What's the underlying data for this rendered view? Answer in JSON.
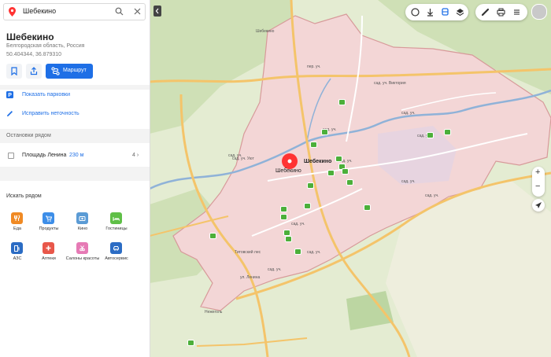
{
  "search": {
    "query": "Шебекино"
  },
  "place": {
    "title": "Шебекино",
    "region": "Белгородская область, Россия",
    "coords": "50.404344, 36.879310"
  },
  "actions": {
    "route_label": "Маршрут",
    "parking_label": "Показать парковки",
    "fix_label": "Исправить неточность"
  },
  "stops": {
    "header": "Остановки рядом",
    "items": [
      {
        "name": "Площадь Ленина",
        "distance": "230 м",
        "count": "4"
      }
    ]
  },
  "nearby": {
    "header": "Искать рядом",
    "categories": [
      {
        "label": "Еда",
        "color": "#f08a24",
        "icon": "food-icon"
      },
      {
        "label": "Продукты",
        "color": "#3d8ee8",
        "icon": "cart-icon"
      },
      {
        "label": "Кино",
        "color": "#5b9bd5",
        "icon": "cinema-icon"
      },
      {
        "label": "Гостиницы",
        "color": "#5fbf47",
        "icon": "hotel-icon"
      },
      {
        "label": "АЗС",
        "color": "#2b6cc4",
        "icon": "fuel-icon"
      },
      {
        "label": "Аптеки",
        "color": "#e8574a",
        "icon": "pharmacy-icon"
      },
      {
        "label": "Салоны красоты",
        "color": "#e67ab5",
        "icon": "beauty-icon"
      },
      {
        "label": "Автосервис",
        "color": "#2b6cc4",
        "icon": "car-service-icon"
      }
    ]
  },
  "map": {
    "city_label": "Шебекино",
    "pin_label": "Шебекино",
    "street_labels": [
      "Шебекино",
      "пер. уч.",
      "сад. уч. Виктория",
      "сад. уч.",
      "сад. уч.",
      "сад. уч.",
      "сад. уч.",
      "сад. уч.",
      "сад. уч.",
      "сад. уч.",
      "сад. уч.",
      "сад. уч. Уют",
      "сад. уч.",
      "ул. Ленина",
      "сад. уч.",
      "Нежеголь",
      "Титовский лес"
    ],
    "colors": {
      "city_fill": "#f3d6d6",
      "city_border": "#d79a9a",
      "river": "#8fb2d8",
      "road": "#f4c46a",
      "forest": "#c9ddb0"
    }
  }
}
